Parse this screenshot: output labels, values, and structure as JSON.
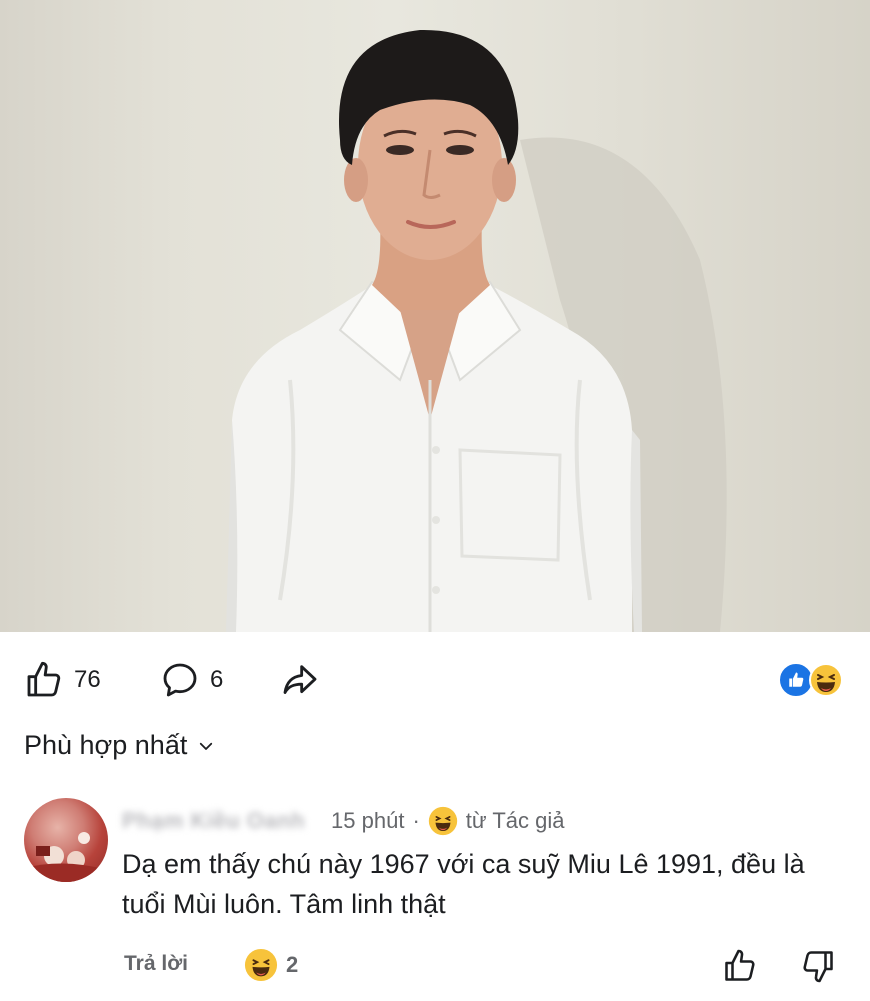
{
  "post": {
    "likes": "76",
    "comments": "6"
  },
  "sort": {
    "label": "Phù hợp nhất"
  },
  "comment": {
    "author": "Phạm Kiều Oanh",
    "time": "15 phút",
    "separator": "·",
    "from_label": "từ Tác giả",
    "text": "Dạ em thấy chú này 1967 với ca suỹ Miu Lê 1991, đều là tuổi Mùi luôn. Tâm linh thật",
    "reply_label": "Trả lời",
    "reaction_count": "2"
  },
  "colors": {
    "accent": "#1b74e4",
    "haha": "#f7c33b",
    "muted_text": "#65676b"
  },
  "icons": [
    "thumbs-up-icon",
    "comment-bubble-icon",
    "share-arrow-icon",
    "like-reaction-icon",
    "haha-reaction-icon",
    "chevron-down-icon",
    "upvote-icon",
    "downvote-icon"
  ]
}
